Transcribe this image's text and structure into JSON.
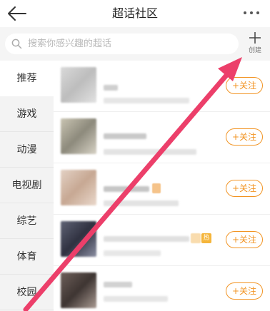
{
  "header": {
    "title": "超话社区",
    "back_icon": "back-arrow-icon",
    "more_icon": "more-dots-icon"
  },
  "search": {
    "placeholder": "搜索你感兴趣的超话",
    "create_label": "创建"
  },
  "sidebar": {
    "items": [
      {
        "label": "推荐",
        "active": true
      },
      {
        "label": "游戏",
        "active": false
      },
      {
        "label": "动漫",
        "active": false
      },
      {
        "label": "电视剧",
        "active": false
      },
      {
        "label": "综艺",
        "active": false
      },
      {
        "label": "体育",
        "active": false
      },
      {
        "label": "校园",
        "active": false
      }
    ]
  },
  "list": {
    "follow_label": "+关注",
    "hot_badge": "热",
    "rows": 5
  },
  "colors": {
    "accent": "#f29423",
    "annotation_arrow": "#ec3f6a"
  }
}
